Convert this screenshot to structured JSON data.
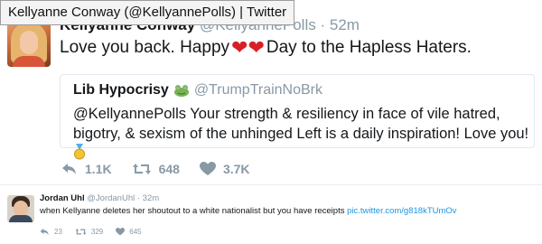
{
  "window_tooltip": "Kellyanne Conway (@KellyannePolls) | Twitter",
  "tweet": {
    "author_name": "Kellyanne Conway",
    "author_handle": "@KellyannePolls",
    "time": "52m",
    "text_before": "Love you back. Happy",
    "text_after": "Day to the Hapless Haters.",
    "heart_emoji_color": "#d81f26",
    "quoted": {
      "author_name": "Lib Hypocrisy",
      "author_handle": "@TrumpTrainNoBrk",
      "text": "@KellyannePolls Your strength & resiliency in face of vile hatred, bigotry, & sexism of the unhinged Left is a daily inspiration! Love you!"
    },
    "actions": {
      "retweets": "1.1K",
      "likes_label": "648",
      "hearts": "3.7K"
    }
  },
  "reply_tweet": {
    "author_name": "Jordan Uhl",
    "author_handle": "@JordanUhl",
    "time": "32m",
    "text": "when Kellyanne deletes her shoutout to a white nationalist but you have receipts",
    "link": "pic.twitter.com/g818kTUmOv",
    "actions": {
      "replies": "23",
      "retweets": "329",
      "likes": "645"
    }
  },
  "colors": {
    "text": "#14171a",
    "muted": "#8899a6",
    "link": "#1b95e0",
    "border": "#e1e8ed"
  }
}
